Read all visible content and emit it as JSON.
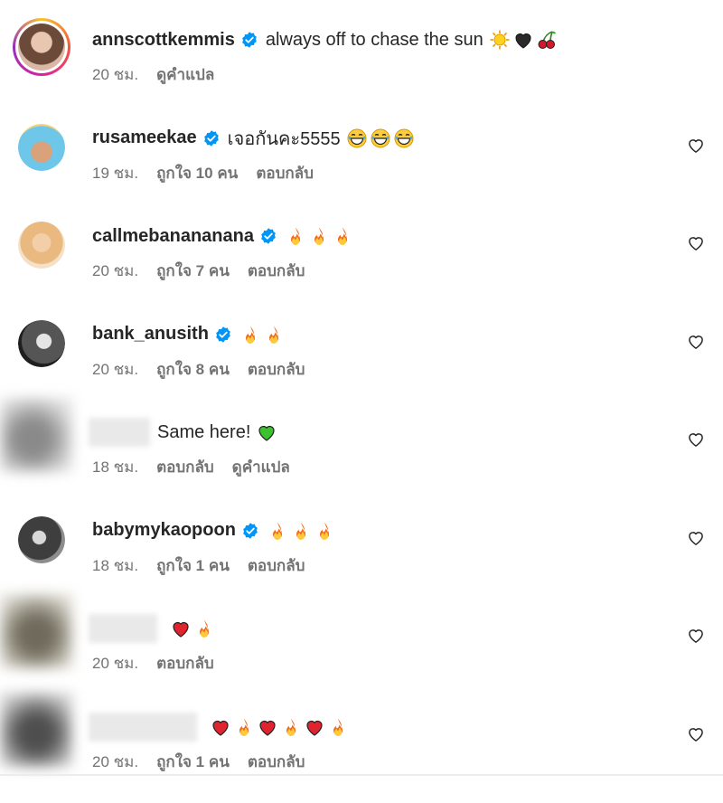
{
  "comments": [
    {
      "username": "annscottkemmis",
      "verified": true,
      "text": "always off to chase the sun",
      "emojis": [
        "sun",
        "black-heart",
        "cherries"
      ],
      "time": "20 ชม.",
      "likes": "",
      "actions": [
        "ดูคำแปล"
      ],
      "has_like_button": false
    },
    {
      "username": "rusameekae",
      "verified": true,
      "text": "เจอกันคะ5555",
      "emojis": [
        "grinning-sweat",
        "grinning-sweat",
        "grinning-sweat"
      ],
      "time": "19 ชม.",
      "likes": "ถูกใจ 10 คน",
      "actions": [
        "ตอบกลับ"
      ],
      "has_like_button": true
    },
    {
      "username": "callmebanananana",
      "verified": true,
      "text": "",
      "emojis": [
        "fire",
        "fire",
        "fire"
      ],
      "time": "20 ชม.",
      "likes": "ถูกใจ 7 คน",
      "actions": [
        "ตอบกลับ"
      ],
      "has_like_button": true
    },
    {
      "username": "bank_anusith",
      "verified": true,
      "text": "",
      "emojis": [
        "fire",
        "fire"
      ],
      "time": "20 ชม.",
      "likes": "ถูกใจ 8 คน",
      "actions": [
        "ตอบกลับ"
      ],
      "has_like_button": true
    },
    {
      "username": "",
      "verified": false,
      "text": "Same here!",
      "emojis": [
        "green-heart"
      ],
      "time": "18 ชม.",
      "likes": "",
      "actions": [
        "ตอบกลับ",
        "ดูคำแปล"
      ],
      "has_like_button": true
    },
    {
      "username": "babymykaopoon",
      "verified": true,
      "text": "",
      "emojis": [
        "fire",
        "fire",
        "fire"
      ],
      "time": "18 ชม.",
      "likes": "ถูกใจ 1 คน",
      "actions": [
        "ตอบกลับ"
      ],
      "has_like_button": true
    },
    {
      "username": "",
      "verified": false,
      "text": "",
      "emojis": [
        "red-heart",
        "fire"
      ],
      "time": "20 ชม.",
      "likes": "",
      "actions": [
        "ตอบกลับ"
      ],
      "has_like_button": true
    },
    {
      "username": "",
      "verified": false,
      "text": "",
      "emojis": [
        "red-heart",
        "fire",
        "red-heart",
        "fire",
        "red-heart",
        "fire"
      ],
      "time": "20 ชม.",
      "likes": "ถูกใจ 1 คน",
      "actions": [
        "ตอบกลับ"
      ],
      "has_like_button": true
    }
  ],
  "colors": {
    "verified": "#0095f6",
    "meta_text": "#737373",
    "username": "#262626"
  }
}
